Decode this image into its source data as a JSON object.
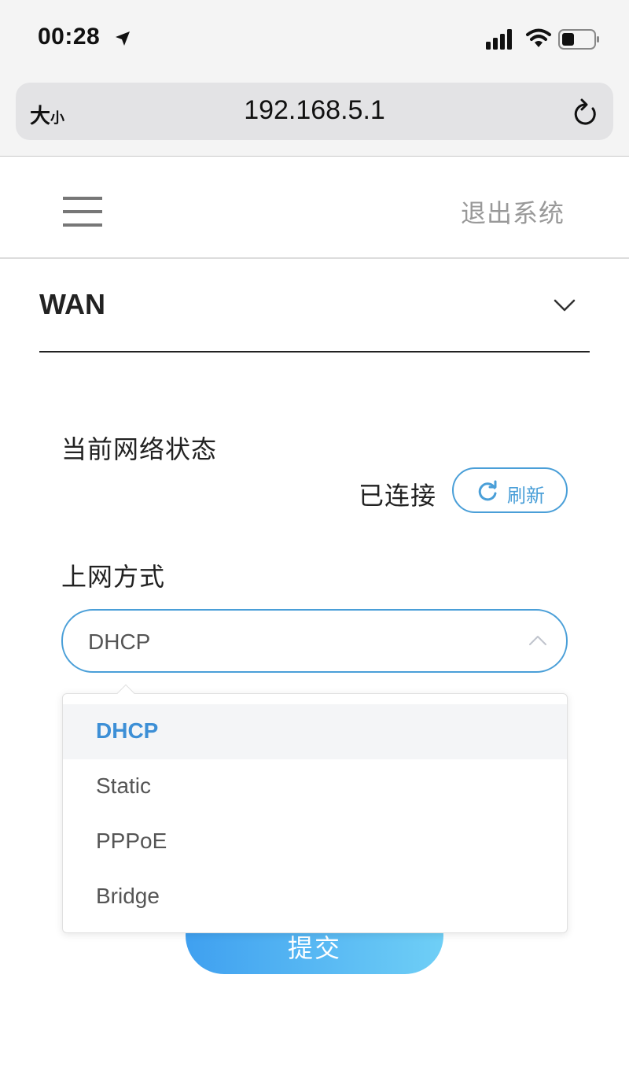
{
  "status_bar": {
    "time": "00:28"
  },
  "browser": {
    "text_size_big": "大",
    "text_size_small": "小",
    "url": "192.168.5.1"
  },
  "header": {
    "logout_label": "退出系统"
  },
  "section": {
    "title": "WAN"
  },
  "network_status": {
    "label": "当前网络状态",
    "value": "已连接",
    "refresh_label": "刷新"
  },
  "connection_type": {
    "label": "上网方式",
    "selected": "DHCP",
    "options": [
      "DHCP",
      "Static",
      "PPPoE",
      "Bridge"
    ]
  },
  "submit_label": "提交",
  "colors": {
    "accent": "#4a9fd8",
    "selected_option_text": "#3d8fd6",
    "submit_gradient_start": "#3fa0f0",
    "submit_gradient_end": "#6fcff6"
  }
}
